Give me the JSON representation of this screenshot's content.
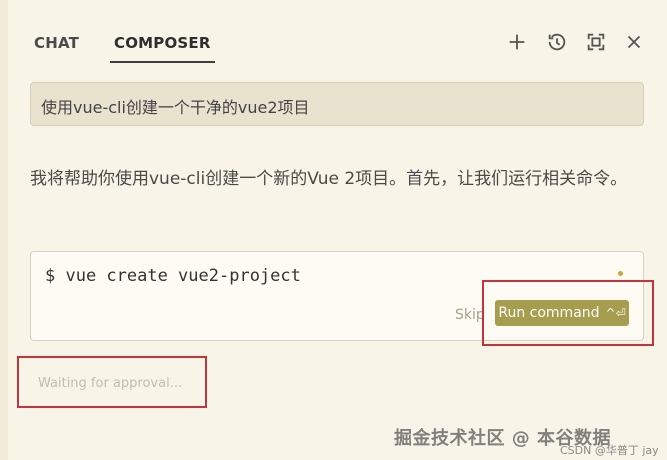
{
  "tabs": {
    "chat": "CHAT",
    "composer": "COMPOSER"
  },
  "toolbar": {
    "icons": [
      "plus-icon",
      "history-icon",
      "maximize-icon",
      "close-icon"
    ]
  },
  "prompt": {
    "text": "使用vue-cli创建一个干净的vue2项目"
  },
  "assistant": {
    "message": "我将帮助你使用vue-cli创建一个新的Vue 2项目。首先，让我们运行相关命令。"
  },
  "command_card": {
    "command": "$ vue create vue2-project",
    "skip_label": "Skip",
    "run_label": "Run command",
    "run_shortcut": "^⏎"
  },
  "status": {
    "waiting": "Waiting for approval..."
  },
  "watermark": {
    "main": "掘金技术社区 @ 本谷数据",
    "sub": "CSDN @华普丁 jay"
  },
  "colors": {
    "background": "#f8f4e8",
    "run_button": "#a79d4f",
    "highlight": "#c8323a"
  }
}
